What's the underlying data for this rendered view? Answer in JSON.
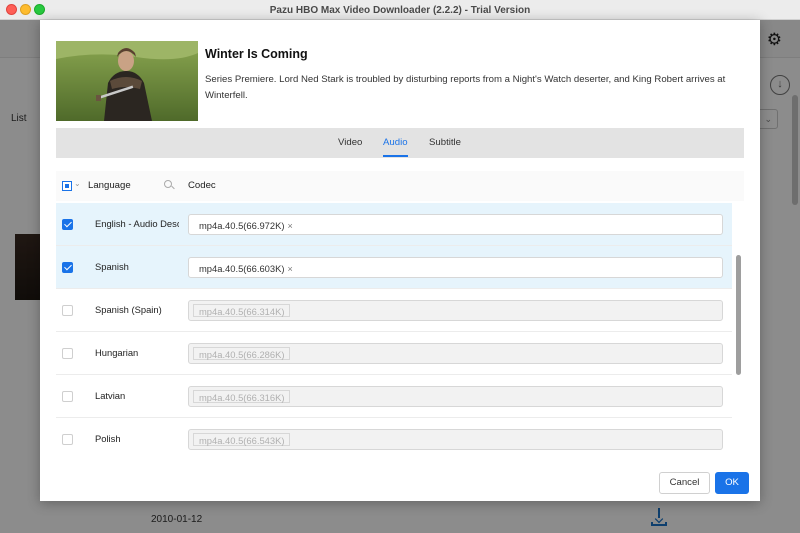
{
  "window": {
    "title": "Pazu HBO Max Video Downloader (2.2.2) - Trial Version"
  },
  "background": {
    "list_label": "List",
    "date": "2010-01-12",
    "gear_icon": "gear-icon",
    "download_icon": "download-icon"
  },
  "episode": {
    "title": "Winter Is Coming",
    "description": "Series Premiere. Lord Ned Stark is troubled by disturbing reports from a Night's Watch deserter, and King Robert arrives at Winterfell."
  },
  "tabs": [
    {
      "label": "Video",
      "active": false
    },
    {
      "label": "Audio",
      "active": true
    },
    {
      "label": "Subtitle",
      "active": false
    }
  ],
  "table": {
    "columns": {
      "language": "Language",
      "codec": "Codec"
    },
    "rows": [
      {
        "language": "English - Audio Description",
        "codec": "mp4a.40.5(66.972K)",
        "checked": true
      },
      {
        "language": "Spanish",
        "codec": "mp4a.40.5(66.603K)",
        "checked": true
      },
      {
        "language": "Spanish (Spain)",
        "codec": "mp4a.40.5(66.314K)",
        "checked": false
      },
      {
        "language": "Hungarian",
        "codec": "mp4a.40.5(66.286K)",
        "checked": false
      },
      {
        "language": "Latvian",
        "codec": "mp4a.40.5(66.316K)",
        "checked": false
      },
      {
        "language": "Polish",
        "codec": "mp4a.40.5(66.543K)",
        "checked": false
      }
    ]
  },
  "buttons": {
    "cancel": "Cancel",
    "ok": "OK"
  },
  "colors": {
    "accent": "#1a73e8",
    "selected_row": "#e6f4fc"
  }
}
